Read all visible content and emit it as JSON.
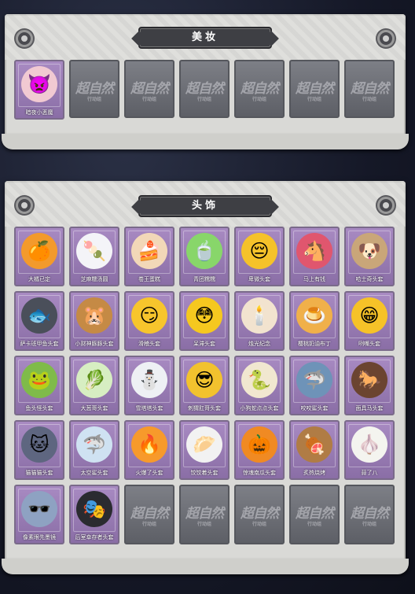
{
  "makeup": {
    "title": "美妆",
    "items": [
      {
        "label": "暗夜小恶魔",
        "emoji": "👿",
        "color": "#f1c9d2"
      }
    ],
    "empty_count": 6
  },
  "headwear": {
    "title": "头饰",
    "items": [
      {
        "label": "大橘已定",
        "emoji": "🍊",
        "color": "#f39a2c"
      },
      {
        "label": "芝麻糯汤圆",
        "emoji": "🍡",
        "color": "#f4f4f8"
      },
      {
        "label": "卷王蛋糕",
        "emoji": "🍰",
        "color": "#f2d8b8"
      },
      {
        "label": "青团糯糯",
        "emoji": "🍵",
        "color": "#88d66a"
      },
      {
        "label": "卑微头套",
        "emoji": "😔",
        "color": "#f5c22a"
      },
      {
        "label": "马上有钱",
        "emoji": "🐴",
        "color": "#e0566e"
      },
      {
        "label": "哈士奇头套",
        "emoji": "🐶",
        "color": "#c9a679"
      },
      {
        "label": "萨卡班甲鱼头套",
        "emoji": "🐟",
        "color": "#4a4f5a"
      },
      {
        "label": "小财神豚豚头套",
        "emoji": "🐹",
        "color": "#c58a45"
      },
      {
        "label": "滑稽头套",
        "emoji": "😏",
        "color": "#f7c52c"
      },
      {
        "label": "呆滞头套",
        "emoji": "😳",
        "color": "#f5c81f"
      },
      {
        "label": "烛光纪念",
        "emoji": "🕯️",
        "color": "#f2e3cf"
      },
      {
        "label": "樱桃奶油布丁",
        "emoji": "🍮",
        "color": "#f0b04a"
      },
      {
        "label": "咧嘴头套",
        "emoji": "😁",
        "color": "#f6c228"
      },
      {
        "label": "鱼头怪头套",
        "emoji": "🐸",
        "color": "#7fbb4a"
      },
      {
        "label": "大葱哥头套",
        "emoji": "🥬",
        "color": "#d7eec2"
      },
      {
        "label": "雪塔塔头套",
        "emoji": "⛄",
        "color": "#eef0f4"
      },
      {
        "label": "刺猬肛哥头套",
        "emoji": "😎",
        "color": "#f2c22e"
      },
      {
        "label": "小狗蛇点点头套",
        "emoji": "🐍",
        "color": "#f1e7d0"
      },
      {
        "label": "咬咬鲨头套",
        "emoji": "🦈",
        "color": "#6e93b8"
      },
      {
        "label": "面具马头套",
        "emoji": "🐎",
        "color": "#6b4430"
      },
      {
        "label": "猫猫猫头套",
        "emoji": "🐱",
        "color": "#5e6680"
      },
      {
        "label": "太空鲨头套",
        "emoji": "🦈",
        "color": "#cfe2f2"
      },
      {
        "label": "火爆了头套",
        "emoji": "🔥",
        "color": "#f79a2b"
      },
      {
        "label": "饺饺着头套",
        "emoji": "🥟",
        "color": "#f2f2f2"
      },
      {
        "label": "惊魂南瓜头套",
        "emoji": "🎃",
        "color": "#f08a23"
      },
      {
        "label": "炙热烧烤",
        "emoji": "🍖",
        "color": "#b07c45"
      },
      {
        "label": "蒜了八",
        "emoji": "🧄",
        "color": "#f4f4ef"
      },
      {
        "label": "像素眼先墨镜",
        "emoji": "🕶️",
        "color": "#8ea2c2"
      },
      {
        "label": "后室幸存者头套",
        "emoji": "🎭",
        "color": "#2a2b30"
      }
    ],
    "empty_count": 5
  },
  "watermark": {
    "main": "超自然",
    "sub": "行动组"
  }
}
